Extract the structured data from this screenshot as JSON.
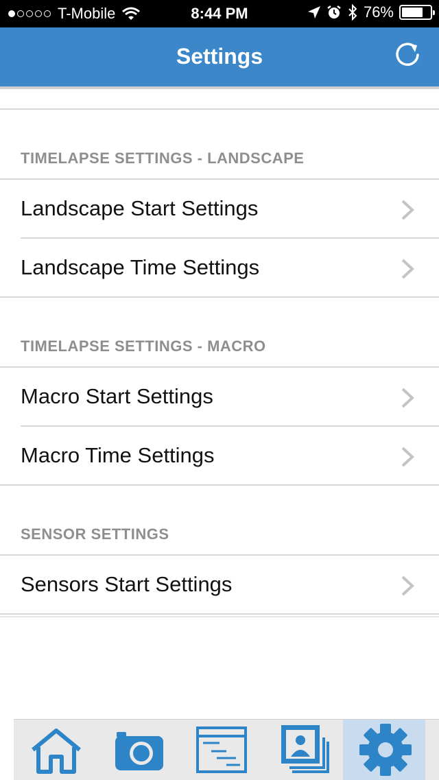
{
  "status_bar": {
    "carrier": "T-Mobile",
    "time": "8:44 PM",
    "battery": "76%",
    "battery_level": 0.76,
    "signal_bars": 1
  },
  "nav": {
    "title": "Settings",
    "refresh_icon": "refresh-icon"
  },
  "sections": [
    {
      "header": "TIMELAPSE SETTINGS - LANDSCAPE",
      "items": [
        "Landscape Start Settings",
        "Landscape Time Settings"
      ]
    },
    {
      "header": "TIMELAPSE SETTINGS - MACRO",
      "items": [
        "Macro Start Settings",
        "Macro Time Settings"
      ]
    },
    {
      "header": "SENSOR SETTINGS",
      "items": [
        "Sensors Start Settings"
      ]
    }
  ],
  "tabs": [
    {
      "icon": "home-icon"
    },
    {
      "icon": "camera-icon"
    },
    {
      "icon": "sequence-icon"
    },
    {
      "icon": "gallery-icon"
    },
    {
      "icon": "gear-icon",
      "active": true
    }
  ],
  "colors": {
    "accent": "#3b87c9",
    "active_tab_bg": "#c9dcef",
    "section_header": "#8e8e8e"
  }
}
